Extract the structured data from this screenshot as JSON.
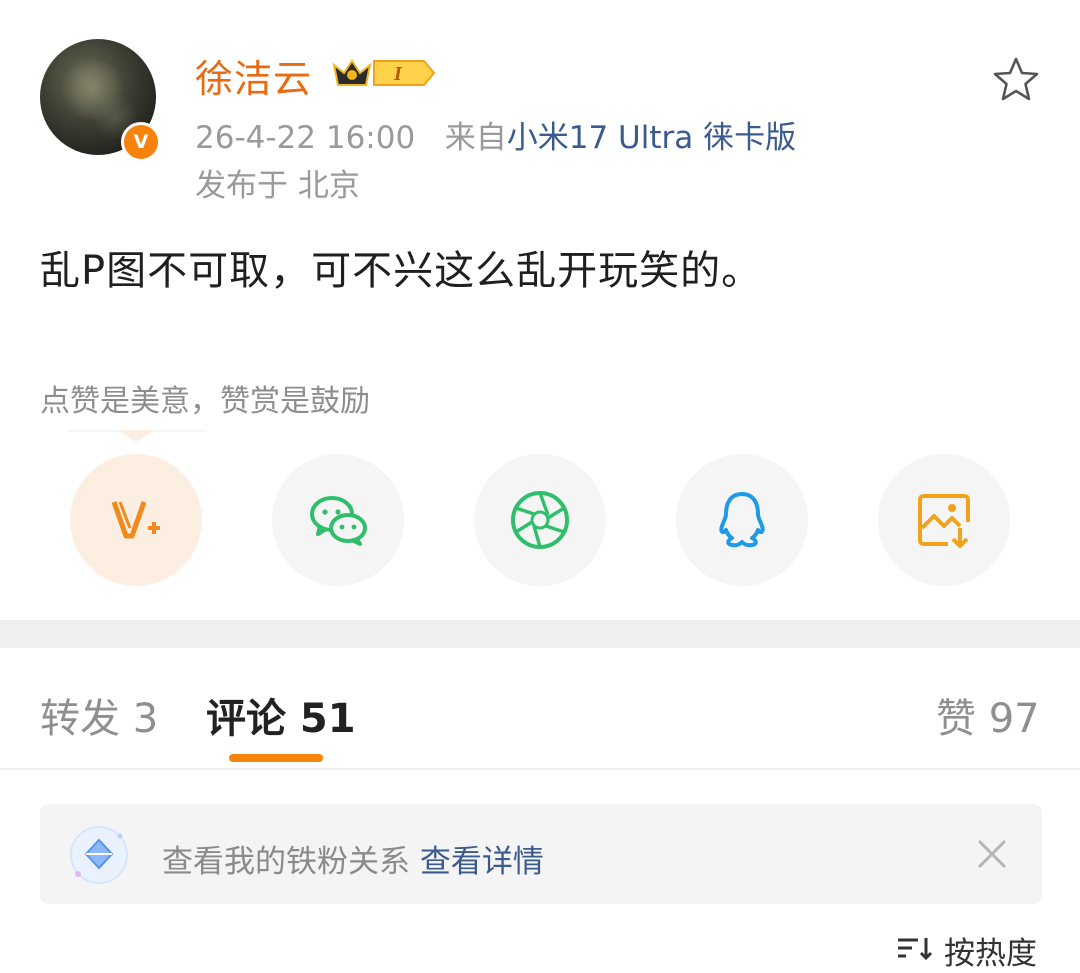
{
  "post": {
    "author": {
      "name": "徐洁云",
      "verified_badge": "V",
      "level_badge": "I"
    },
    "timestamp": "26-4-22 16:00",
    "source_prefix": "来自",
    "source_device": "小米17 Ultra 徕卡版",
    "location": "发布于 北京",
    "content": "乱P图不可取，可不兴这么乱开玩笑的。"
  },
  "reward": {
    "hint": "点赞是美意，赞赏是鼓励"
  },
  "share_buttons": [
    {
      "name": "vplus",
      "icon": "v-plus-icon",
      "color": "#f08a1c"
    },
    {
      "name": "wechat",
      "icon": "wechat-icon",
      "color": "#2fbf6c"
    },
    {
      "name": "moments",
      "icon": "moments-shutter-icon",
      "color": "#2fbf6c"
    },
    {
      "name": "qq",
      "icon": "qq-penguin-icon",
      "color": "#1e9ae8"
    },
    {
      "name": "save-image",
      "icon": "save-image-icon",
      "color": "#f0a21c"
    }
  ],
  "tabs": {
    "repost": "转发 3",
    "comment": "评论 51",
    "like": "赞 97"
  },
  "fan_bar": {
    "text": "查看我的铁粉关系",
    "link": "查看详情"
  },
  "sort": {
    "label": "按热度"
  },
  "colors": {
    "accent": "#f7820c",
    "username": "#e86a12",
    "link": "#3a5b8c"
  }
}
